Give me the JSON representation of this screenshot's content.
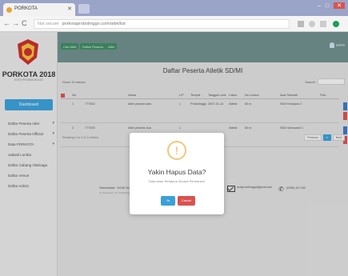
{
  "browser": {
    "tab_title": "PORKOTA",
    "url_prefix": "Not secure",
    "url": "porkotaprobolinggo.com/atlet/list"
  },
  "sidebar": {
    "app_name": "PORKOTA 2018",
    "app_sub": "KOTA PROBOLINGGO",
    "dashboard_label": "Dashboard",
    "items": [
      {
        "label": "Daftar Peserta Atlet"
      },
      {
        "label": "Daftar Peserta Official"
      },
      {
        "label": "Data PORKOTA"
      },
      {
        "label": "Jadwal Lomba"
      },
      {
        "label": "Daftar Cabang Olahraga"
      },
      {
        "label": "Daftar Venue"
      },
      {
        "label": "Daftar Admin"
      }
    ]
  },
  "topnav": {
    "pills": [
      "Cari Atlet",
      "Daftar Peserta",
      "Atlet"
    ],
    "user": "admin"
  },
  "main": {
    "title": "Daftar Peserta Atletik SD/MI",
    "show_label": "Show 10 entries",
    "search_label": "Search:",
    "columns": [
      "No",
      "Nama",
      "L/P",
      "Tempat",
      "Tanggal Lahir",
      "Cabor",
      "No Lomba",
      "Asal Sekolah",
      "Foto"
    ],
    "rows": [
      {
        "no": "1",
        "id": "777002",
        "nama": "Atlet peserta satu",
        "jk": "L",
        "tempat": "Probolinggo",
        "tgl": "2007-01-10",
        "cabor": "Atletik",
        "nomor": "60 m",
        "ket": "SDN Kedopok 2"
      },
      {
        "no": "2",
        "id": "777003",
        "nama": "Atlet peserta dua",
        "jk": "L",
        "tempat": "",
        "tgl": "",
        "cabor": "Atletik",
        "nomor": "60 m",
        "ket": "SDN Wonoasih 1"
      }
    ],
    "showing": "Showing 1 to 2 of 2 entries",
    "pager": [
      "Previous",
      "1",
      "Next"
    ]
  },
  "footer": {
    "org": "Sekretariat : KONI Kota Probolinggo",
    "addr": "Jl. Suroyo No. 12, Probolinggo",
    "email": "koniprobolinggo@gmail.com",
    "phone": "(0335) 421 000"
  },
  "modal": {
    "icon": "!",
    "title": "Yakin Hapus Data?",
    "text": "Data Akan Terhapus Secara Permanen!",
    "ok_label": "Ya",
    "cancel_label": "Cancel"
  },
  "colors": {
    "accent": "#3ba0d8",
    "danger": "#d9534f",
    "topnav": "#6f8f8c",
    "pill": "#3f8c62"
  }
}
